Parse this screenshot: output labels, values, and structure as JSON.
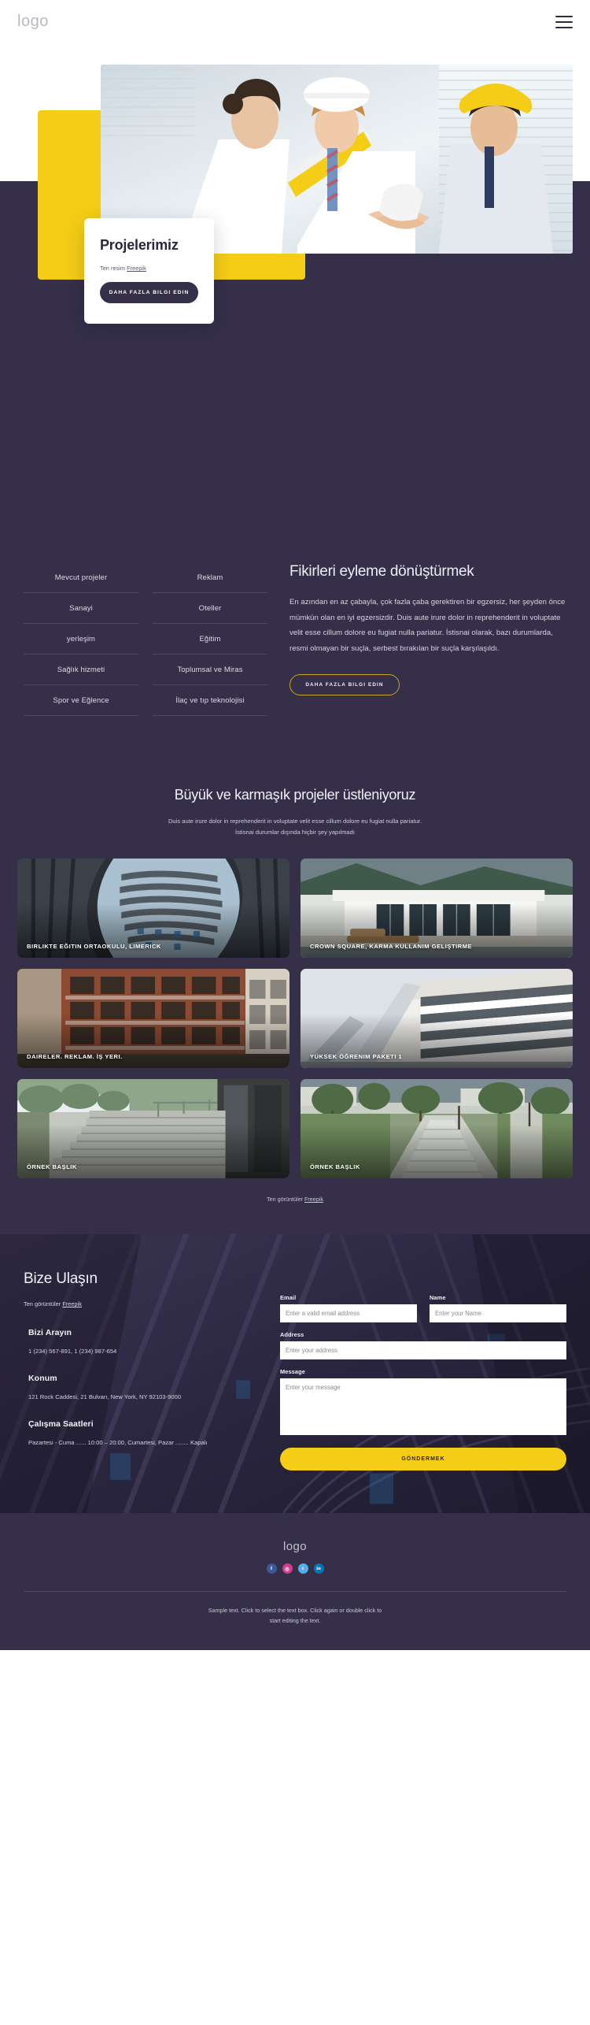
{
  "header": {
    "logo": "logo",
    "menu_icon": "hamburger-menu-icon"
  },
  "hero": {
    "title": "Projelerimiz",
    "credit_prefix": "Ten resim ",
    "credit_link": "Freepik",
    "cta": "DAHA FAZLA BILGI EDIN"
  },
  "ideas": {
    "list": [
      "Mevcut projeler",
      "Reklam",
      "Sanayi",
      "Oteller",
      "yerleşim",
      "Eğitim",
      "Sağlık hizmeti",
      "Toplumsal ve Miras",
      "Spor ve Eğlence",
      "İlaç ve tıp teknolojisi"
    ],
    "heading": "Fikirleri eyleme dönüştürmek",
    "paragraph": "En azından en az çabayla, çok fazla çaba gerektiren bir egzersiz, her şeyden önce mümkün olan en iyi egzersizdir. Duis aute irure dolor in reprehenderit in voluptate velit esse cillum dolore eu fugiat nulla pariatur. İstisnai olarak, bazı durumlarda, resmi olmayan bir suçla, serbest bırakılan bir suçla karşılaşıldı.",
    "cta": "DAHA FAZLA BILGI EDIN"
  },
  "projects": {
    "heading": "Büyük ve karmaşık projeler üstleniyoruz",
    "sub_line1": "Duis aute irure dolor in reprehenderit in voluptate velit esse cillum dolore eu fugiat nulla pariatur.",
    "sub_line2": "İstisnai durumlar dışında hiçbir şey yapılmadı",
    "cards": [
      {
        "caption": "BIRLIKTE EĞITIN ORTAOKULU, LIMERICK"
      },
      {
        "caption": "CROWN SQUARE, KARMA KULLANIM GELIŞTIRME"
      },
      {
        "caption": "DAIRELER. REKLAM. İŞ YERI."
      },
      {
        "caption": "YÜKSEK ÖĞRENIM PAKETI 1"
      },
      {
        "caption": "ÖRNEK BAŞLIK"
      },
      {
        "caption": "ÖRNEK BAŞLIK"
      }
    ],
    "credit_prefix": "Ten görüntüler ",
    "credit_link": "Freepik"
  },
  "contact": {
    "heading": "Bize Ulaşın",
    "credit_prefix": "Ten görüntüler ",
    "credit_link": "Freepik",
    "blocks": [
      {
        "title": "Bizi Arayın",
        "text": "1 (234) 567-891, 1 (234) 987-654"
      },
      {
        "title": "Konum",
        "text": "121 Rock Caddesi, 21 Bulvarı, New York, NY 92103-9000"
      },
      {
        "title": "Çalışma Saatleri",
        "text": "Pazartesi - Cuma ...... 10:00 – 20:00, Cumartesi, Pazar ........ Kapalı"
      }
    ],
    "form": {
      "email_label": "Email",
      "email_placeholder": "Enter a valid email address",
      "name_label": "Name",
      "name_placeholder": "Enter your Name",
      "address_label": "Address",
      "address_placeholder": "Enter your address",
      "message_label": "Message",
      "message_placeholder": "Enter your message",
      "submit": "GÖNDERMEK"
    }
  },
  "footer": {
    "logo": "logo",
    "socials": [
      {
        "name": "facebook-icon",
        "glyph": "f"
      },
      {
        "name": "instagram-icon",
        "glyph": "◎"
      },
      {
        "name": "twitter-icon",
        "glyph": "t"
      },
      {
        "name": "linkedin-icon",
        "glyph": "in"
      }
    ],
    "text_line1": "Sample text. Click to select the text box. Click again or double click to",
    "text_line2": "start editing the text."
  },
  "colors": {
    "dark": "#352f4a",
    "yellow": "#f5cd17",
    "gold": "#c9a227"
  }
}
